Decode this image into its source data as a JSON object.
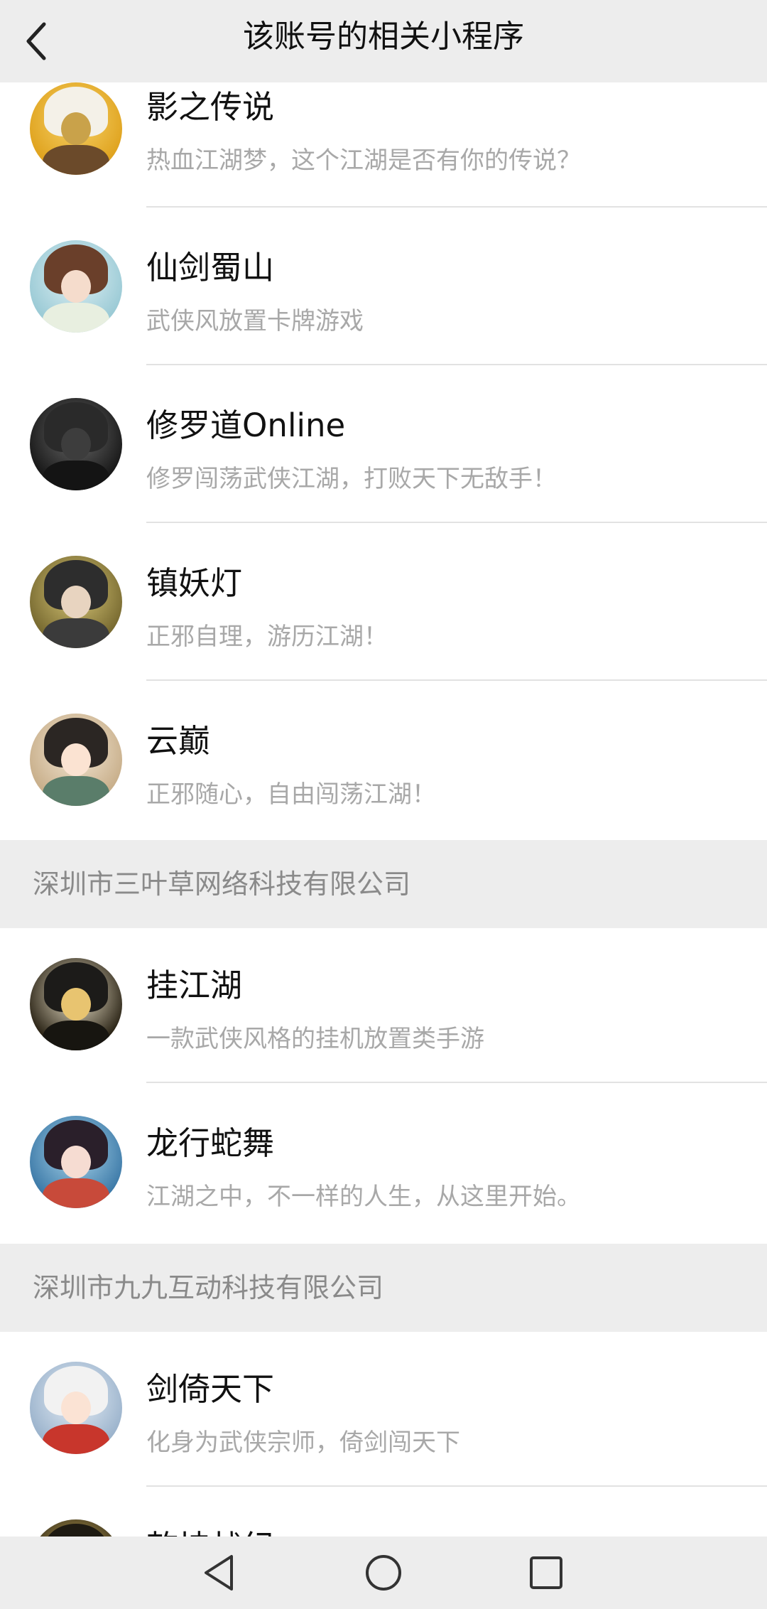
{
  "header": {
    "title": "该账号的相关小程序"
  },
  "sections": [
    {
      "company": "",
      "items": [
        {
          "name": "影之传说",
          "desc": "热血江湖梦，这个江湖是否有你的传说？",
          "avatar_icon": "hooded-warrior-avatar"
        },
        {
          "name": "仙剑蜀山",
          "desc": "武侠风放置卡牌游戏",
          "avatar_icon": "swordswoman-avatar"
        },
        {
          "name": "修罗道Online",
          "desc": "修罗闯荡武侠江湖，打败天下无敌手！",
          "avatar_icon": "straw-hat-swordsman-avatar"
        },
        {
          "name": "镇妖灯",
          "desc": "正邪自理，游历江湖！",
          "avatar_icon": "long-haired-sage-avatar"
        },
        {
          "name": "云巅",
          "desc": "正邪随心，自由闯荡江湖！",
          "avatar_icon": "chibi-boy-avatar"
        }
      ]
    },
    {
      "company": "深圳市三叶草网络科技有限公司",
      "items": [
        {
          "name": "挂江湖",
          "desc": "一款武侠风格的挂机放置类手游",
          "avatar_icon": "lightning-swordsman-avatar"
        },
        {
          "name": "龙行蛇舞",
          "desc": "江湖之中，不一样的人生，从这里开始。",
          "avatar_icon": "red-flower-maiden-avatar"
        }
      ]
    },
    {
      "company": "深圳市九九互动科技有限公司",
      "items": [
        {
          "name": "剑倚天下",
          "desc": "化身为武侠宗师，倚剑闯天下",
          "avatar_icon": "chibi-swordsman-avatar"
        },
        {
          "name": "乾坤战纪",
          "desc": "",
          "avatar_icon": "golden-warrior-avatar"
        }
      ]
    }
  ],
  "nav": {
    "back_icon": "triangle-back-icon",
    "home_icon": "circle-home-icon",
    "recent_icon": "square-recents-icon"
  },
  "colors": {
    "header_bg": "#ededed",
    "section_bg": "#ededed",
    "title": "#111111",
    "desc": "#a8a8a8",
    "company": "#8a8a8a"
  }
}
